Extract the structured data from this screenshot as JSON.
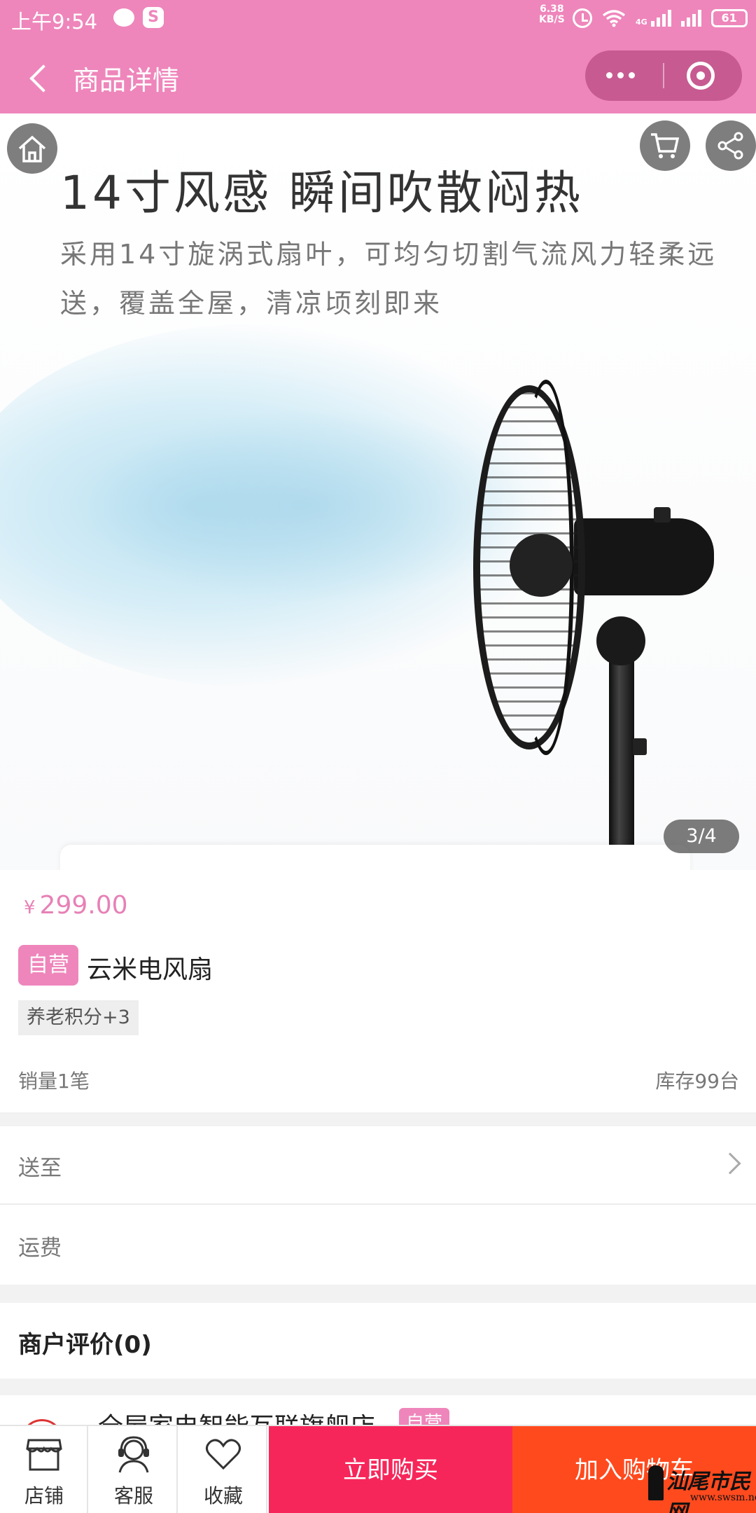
{
  "status_bar": {
    "time": "上午9:54",
    "net_speed_value": "6.38",
    "net_speed_unit": "KB/S",
    "network_type": "4G",
    "battery": "61"
  },
  "nav": {
    "title": "商品详情"
  },
  "hero": {
    "headline": "14寸风感 瞬间吹散闷热",
    "subline": "采用14寸旋涡式扇叶，可均匀切割气流风力轻柔远送，覆盖全屋，清凉顷刻即来",
    "page_indicator": "3/4"
  },
  "product": {
    "currency": "¥",
    "price": "299.00",
    "self_badge": "自营",
    "name": "云米电风扇",
    "points_tag": "养老积分+3",
    "sales": "销量1笔",
    "stock": "库存99台"
  },
  "shipping": {
    "deliver_to_label": "送至",
    "freight_label": "运费"
  },
  "reviews": {
    "title": "商户评价(0)"
  },
  "store": {
    "name": "全屋家电智能互联旗舰店",
    "badge": "自营"
  },
  "bottom_bar": {
    "shop_label": "店铺",
    "service_label": "客服",
    "favorite_label": "收藏",
    "buy_now_label": "立即购买",
    "add_to_cart_label": "加入购物车"
  },
  "watermark": {
    "text": "汕尾市民网",
    "url": "www.swsm.net"
  },
  "colors": {
    "brand_pink": "#ee86bb",
    "buy_red": "#f7265a",
    "cart_orange": "#ff4a1e",
    "price_pink": "#e781b6"
  }
}
